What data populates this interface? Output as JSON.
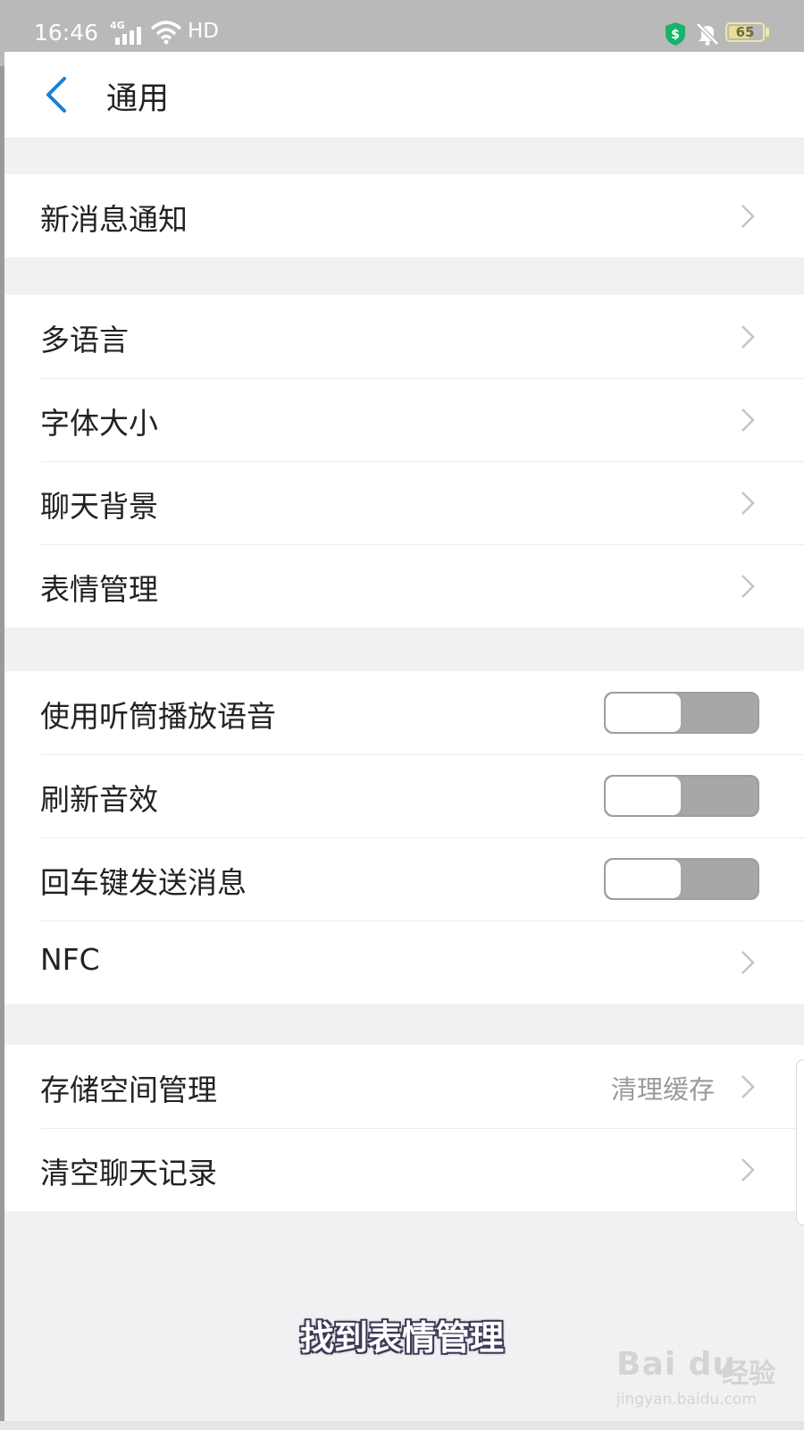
{
  "status_bar": {
    "time": "16:46",
    "network": "4G",
    "hd": "HD",
    "battery": 65
  },
  "header": {
    "title": "通用"
  },
  "groups": [
    {
      "rows": [
        {
          "label": "新消息通知"
        }
      ]
    },
    {
      "rows": [
        {
          "label": "多语言"
        },
        {
          "label": "字体大小"
        },
        {
          "label": "聊天背景"
        },
        {
          "label": "表情管理"
        }
      ]
    },
    {
      "rows": [
        {
          "label": "使用听筒播放语音",
          "toggle": false
        },
        {
          "label": "刷新音效",
          "toggle": false
        },
        {
          "label": "回车键发送消息",
          "toggle": false
        },
        {
          "label": "NFC"
        }
      ]
    },
    {
      "rows": [
        {
          "label": "存储空间管理",
          "value": "清理缓存"
        },
        {
          "label": "清空聊天记录"
        }
      ]
    }
  ],
  "caption": "找到表情管理",
  "watermark": {
    "logo": "Bai du",
    "text": "经验",
    "url": "jingyan.baidu.com"
  },
  "colors": {
    "accent": "#1a7fd9",
    "toggle_off": "#a7a8a6"
  }
}
